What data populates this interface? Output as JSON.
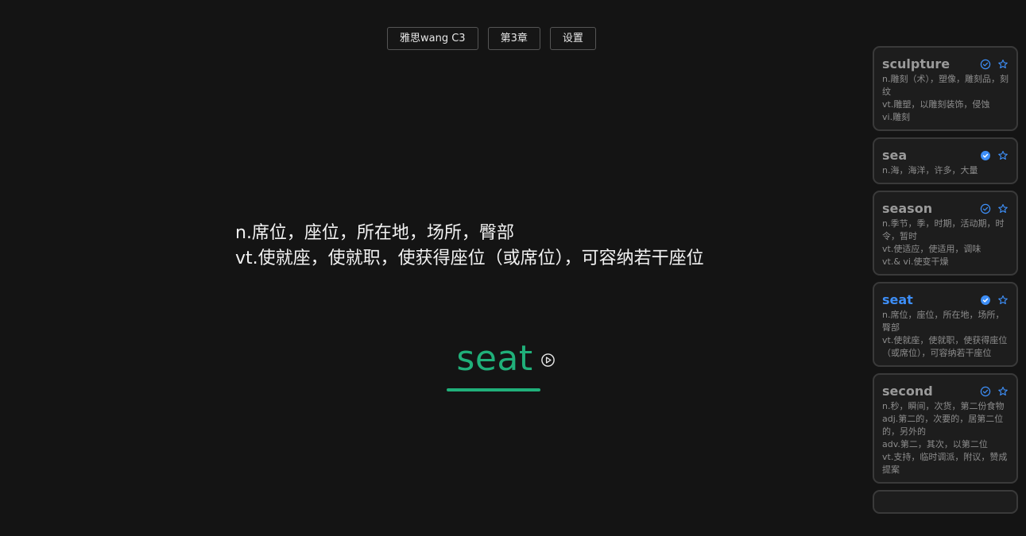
{
  "toolbar": {
    "dict_label": "雅思wang C3",
    "chapter_label": "第3章",
    "settings_label": "设置"
  },
  "current": {
    "word": "seat",
    "definition": [
      "n.席位，座位，所在地，场所，臀部",
      "vt.使就座，使就职，使获得座位（或席位），可容纳若干座位"
    ],
    "colors": {
      "word": "#20b07a",
      "accent": "#3d8ef7"
    },
    "icons": {
      "play": "play-circle-icon"
    }
  },
  "word_list": [
    {
      "word": "sculpture",
      "active": false,
      "checked": false,
      "translations": [
        "n.雕刻（术），塑像，雕刻品，刻纹",
        "vt.雕塑，以雕刻装饰，侵蚀",
        "vi.雕刻"
      ]
    },
    {
      "word": "sea",
      "active": false,
      "checked": true,
      "translations": [
        "n.海，海洋，许多，大量"
      ]
    },
    {
      "word": "season",
      "active": false,
      "checked": false,
      "translations": [
        "n.季节，季，时期，活动期，时令，暂时",
        "vt.使适应，使适用，调味",
        "vt.& vi.使变干燥"
      ]
    },
    {
      "word": "seat",
      "active": true,
      "checked": true,
      "translations": [
        "n.席位，座位，所在地，场所，臀部",
        "vt.使就座，使就职，使获得座位（或席位），可容纳若干座位"
      ]
    },
    {
      "word": "second",
      "active": false,
      "checked": false,
      "translations": [
        "n.秒，瞬间，次货，第二份食物",
        "adj.第二的，次要的，居第二位的，另外的",
        "adv.第二，其次，以第二位",
        "vt.支持，临时调派，附议，赞成提案"
      ]
    }
  ]
}
